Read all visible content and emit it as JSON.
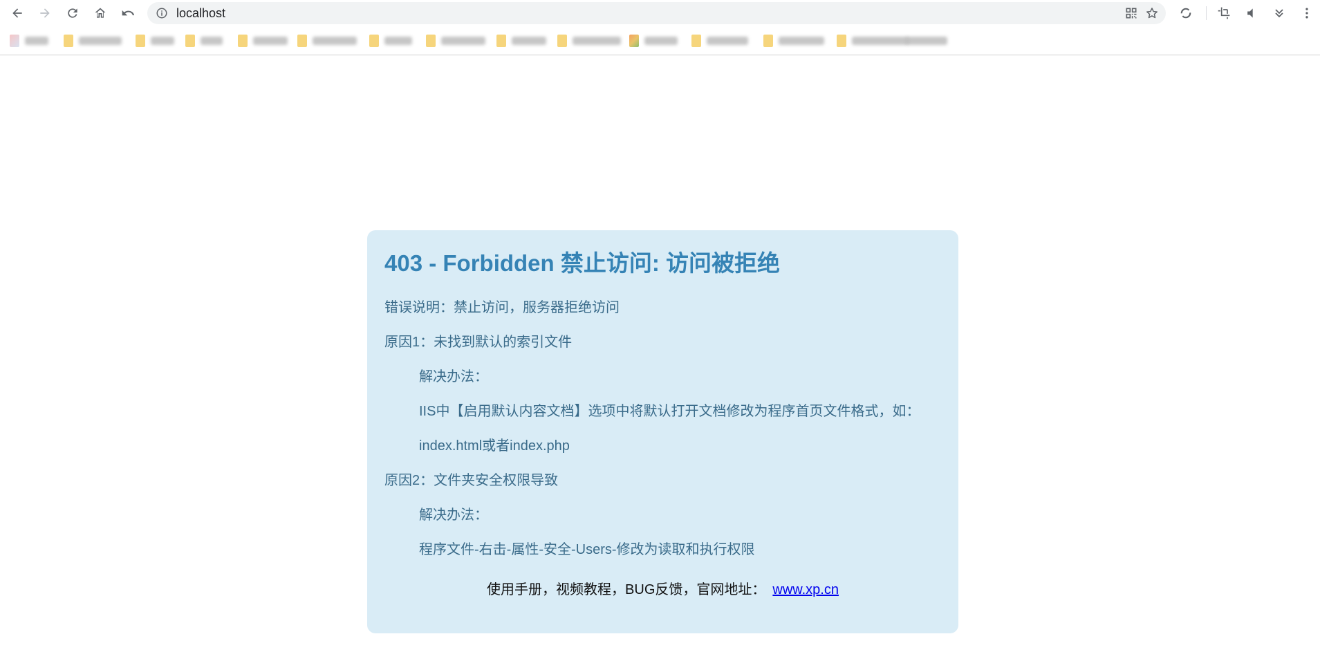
{
  "browser": {
    "url": "localhost",
    "icons": [
      "back-icon",
      "forward-icon",
      "reload-icon",
      "home-icon",
      "undo-icon",
      "info-icon",
      "qr-code-icon",
      "star-icon",
      "extension-icon",
      "crop-icon",
      "mute-icon",
      "chevrons-down-icon",
      "more-vert-icon"
    ]
  },
  "bookmarks": {
    "count": 16,
    "note_visible": false
  },
  "error": {
    "title": "403 - Forbidden 禁止访问: 访问被拒绝",
    "description": "错误说明：禁止访问，服务器拒绝访问",
    "reason1": "原因1：未找到默认的索引文件",
    "reason1_solution_label": "解决办法：",
    "reason1_solution_text": "IIS中【启用默认内容文档】选项中将默认打开文档修改为程序首页文件格式，如：",
    "reason1_solution_example": "index.html或者index.php",
    "reason2": "原因2：文件夹安全权限导致",
    "reason2_solution_label": "解决办法：",
    "reason2_solution_text": "程序文件-右击-属性-安全-Users-修改为读取和执行权限",
    "footer_text": "使用手册，视频教程，BUG反馈，官网地址：",
    "footer_link": "www.xp.cn"
  },
  "colors": {
    "box_background": "#d9ecf6",
    "title": "#3583b5",
    "body_text": "#3a6b8a",
    "link": "#0000ee"
  }
}
